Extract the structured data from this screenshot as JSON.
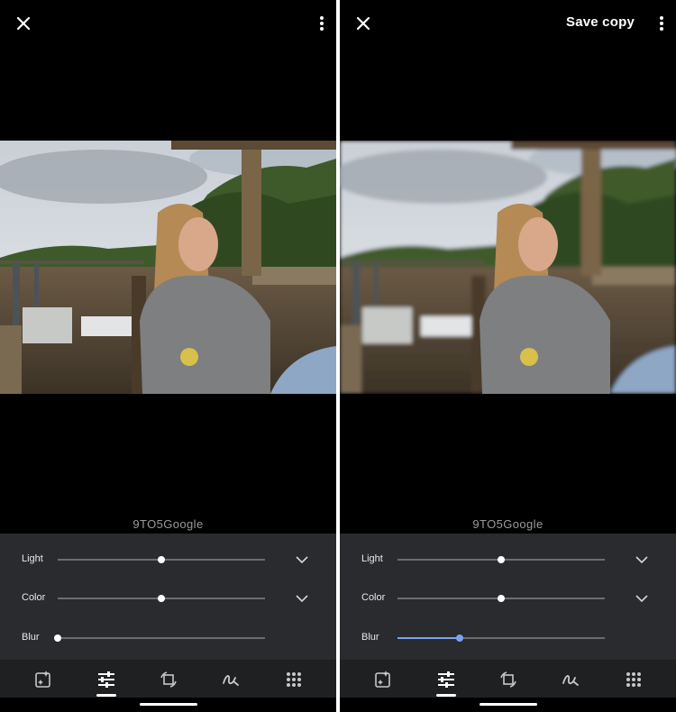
{
  "watermark": "9TO5Google",
  "left": {
    "header": {
      "close_icon": "close-icon",
      "more_icon": "more-vert-icon"
    },
    "adjustments": [
      {
        "label": "Light",
        "value": 0.5,
        "expandable": true
      },
      {
        "label": "Color",
        "value": 0.5,
        "expandable": true
      },
      {
        "label": "Blur",
        "value": 0.0,
        "expandable": false
      }
    ]
  },
  "right": {
    "header": {
      "save_copy": "Save copy",
      "close_icon": "close-icon",
      "more_icon": "more-vert-icon"
    },
    "adjustments": [
      {
        "label": "Light",
        "value": 0.5,
        "expandable": true
      },
      {
        "label": "Color",
        "value": 0.5,
        "expandable": true
      },
      {
        "label": "Blur",
        "value": 0.3,
        "expandable": false
      }
    ]
  },
  "toolbar": {
    "tools": [
      "suggestions-icon",
      "adjust-icon",
      "crop-rotate-icon",
      "markup-icon",
      "more-tools-icon"
    ],
    "active": "adjust-icon"
  },
  "colors": {
    "accent": "#7aa3ee",
    "panel": "#2a2b2e",
    "toolbar": "#1f2022"
  }
}
